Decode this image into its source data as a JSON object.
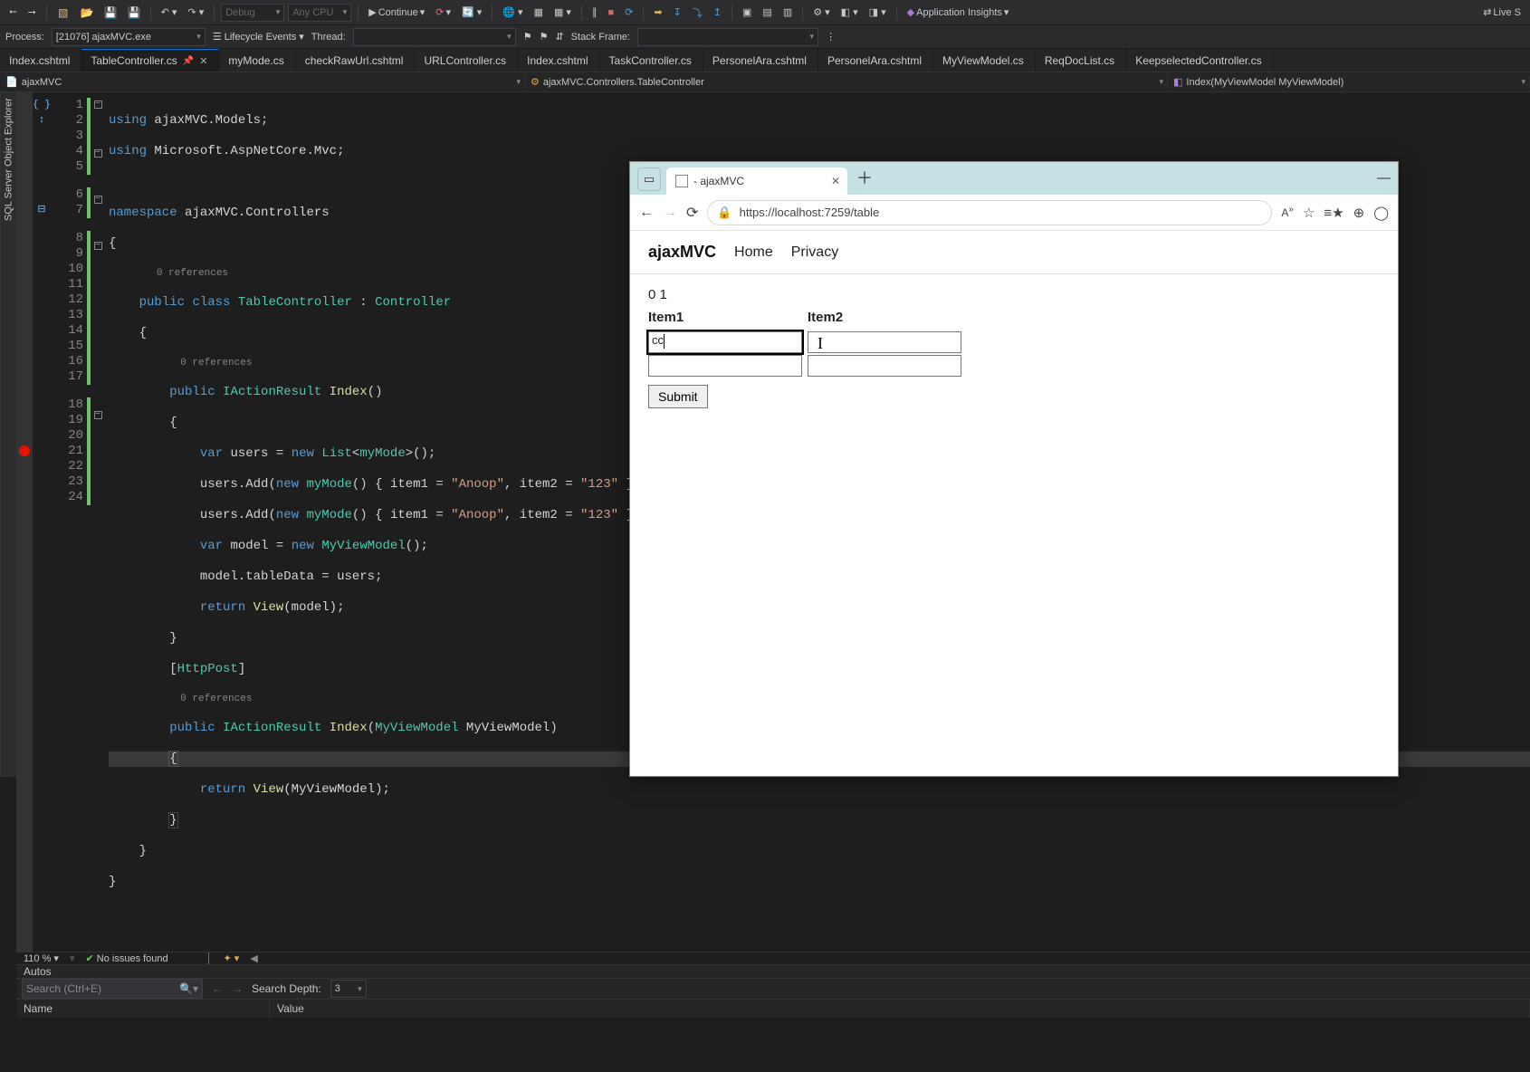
{
  "toolbar": {
    "continue_label": "Continue",
    "config_label": "Debug",
    "platform_label": "Any CPU",
    "app_insights": "Application Insights",
    "live_share": "Live S"
  },
  "process_row": {
    "process_label": "Process:",
    "process_value": "[21076] ajaxMVC.exe",
    "lifecycle": "Lifecycle Events",
    "thread_label": "Thread:",
    "stack_label": "Stack Frame:"
  },
  "tabs": [
    "Index.cshtml",
    "TableController.cs",
    "myMode.cs",
    "checkRawUrl.cshtml",
    "URLController.cs",
    "Index.cshtml",
    "TaskController.cs",
    "PersonelAra.cshtml",
    "PersonelAra.cshtml",
    "MyViewModel.cs",
    "ReqDocList.cs",
    "KeepselectedController.cs"
  ],
  "active_tab_index": 1,
  "navbar": {
    "project": "ajaxMVC",
    "scope": "ajaxMVC.Controllers.TableController",
    "member": "Index(MyViewModel MyViewModel)"
  },
  "line_numbers": [
    "1",
    "2",
    "3",
    "4",
    "5",
    "6",
    "7",
    "8",
    "9",
    "10",
    "11",
    "12",
    "13",
    "14",
    "15",
    "16",
    "17",
    "18",
    "19",
    "20",
    "21",
    "22",
    "23",
    "24"
  ],
  "codelens": {
    "refs0": "0 references"
  },
  "code": {
    "l1_using": "using",
    "l1_ns": "ajaxMVC.Models",
    "semi": ";",
    "l2_ns": "Microsoft.AspNetCore.Mvc",
    "l4_kw": "namespace",
    "l4_ns": "ajaxMVC.Controllers",
    "open_brace": "{",
    "close_brace": "}",
    "public": "public",
    "class_kw": "class",
    "cls": "TableController",
    "colon": " : ",
    "base": "Controller",
    "ret_t": "IActionResult",
    "idx": "Index",
    "call": "()",
    "var": "var",
    "users": "users",
    "eq": " = ",
    "new": "new",
    "list_t": "List",
    "lt": "<",
    "myMode": "myMode",
    "gt": ">",
    "add": "users.Add",
    "new_mymode": "new myMode()",
    "body_open": " { ",
    "item1": "item1",
    "item2": "item2",
    "eq2": " = ",
    "anoop": "\"Anoop\"",
    "s123": "\"123\"",
    "comma": ", ",
    "body_close": " });",
    "model": "model",
    "myvm": "MyViewModel",
    "call2": "();",
    "modeltd": "model.tableData",
    "assign_users": " = users;",
    "return": "return",
    "view": "View",
    "argModel": "(model);",
    "httppost": "[HttpPost]",
    "sig2": "(MyViewModel MyViewModel)",
    "view2_arg": "(MyViewModel);"
  },
  "status": {
    "zoom": "110 %",
    "issues": "No issues found"
  },
  "autos": {
    "title": "Autos",
    "search_placeholder": "Search (Ctrl+E)",
    "depth_label": "Search Depth:",
    "depth_value": "3",
    "col_name": "Name",
    "col_value": "Value"
  },
  "side_panel": {
    "sql": "SQL Server Object Explorer"
  },
  "browser": {
    "tab_title": " - ajaxMVC",
    "url": "https://localhost:7259/table",
    "winmin": "—",
    "brand": "ajaxMVC",
    "nav_home": "Home",
    "nav_privacy": "Privacy",
    "counter": "0 1",
    "th1": "Item1",
    "th2": "Item2",
    "row1_item1": "cc",
    "submit": "Submit"
  }
}
